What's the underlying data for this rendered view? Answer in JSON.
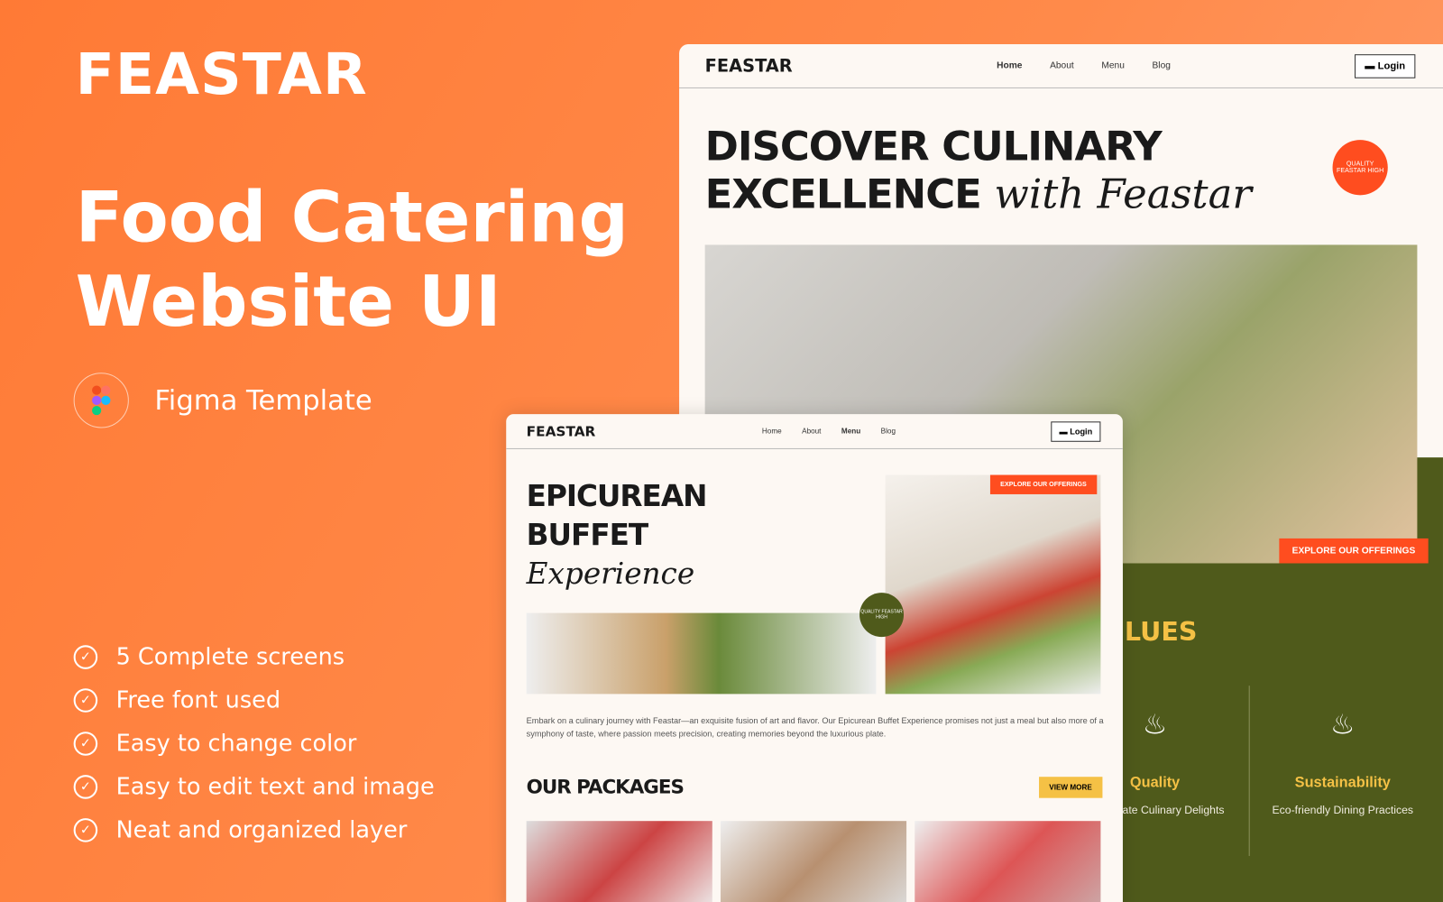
{
  "promo": {
    "logo": "FEASTAR",
    "title_line1": "Food Catering",
    "title_line2": "Website UI",
    "figma_label": "Figma Template",
    "features": [
      "5 Complete screens",
      "Free font used",
      "Easy to change color",
      "Easy to edit text and image",
      "Neat and organized layer"
    ]
  },
  "colors": {
    "orange": "#ff7a35",
    "accent": "#ff4d1f",
    "olive": "#4f5a1b",
    "yellow": "#f5c145",
    "cream": "#fdf8f3"
  },
  "site_home": {
    "logo": "FEASTAR",
    "nav": [
      "Home",
      "About",
      "Menu",
      "Blog"
    ],
    "active_nav": "Home",
    "login": "Login",
    "headline_line1": "DISCOVER CULINARY",
    "headline_line2": "EXCELLENCE",
    "headline_script": "with Feastar",
    "badge": "QUALITY FEASTAR HIGH",
    "explore": "EXPLORE OUR OFFERINGS",
    "values_title": "LUES",
    "values": [
      {
        "title": "Quality",
        "desc": "ce to Plate Culinary Delights"
      },
      {
        "title": "Sustainability",
        "desc": "Eco-friendly Dining Practices"
      }
    ]
  },
  "site_menu": {
    "logo": "FEASTAR",
    "nav": [
      "Home",
      "About",
      "Menu",
      "Blog"
    ],
    "active_nav": "Menu",
    "login": "Login",
    "headline_line1": "EPICUREAN",
    "headline_line2": "BUFFET",
    "headline_script": "Experience",
    "badge": "QUALITY FEASTAR HIGH",
    "explore": "EXPLORE OUR OFFERINGS",
    "body": "Embark on a culinary journey with Feastar—an exquisite fusion of art and flavor. Our Epicurean Buffet Experience promises not just a meal but also more of a symphony of taste, where passion meets precision, creating memories beyond the luxurious plate.",
    "packages_title": "OUR PACKAGES",
    "view_more": "VIEW MORE"
  }
}
